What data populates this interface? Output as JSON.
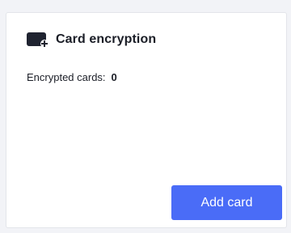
{
  "card": {
    "icon": "card-add-icon",
    "title": "Card encryption",
    "stat_label": "Encrypted cards:",
    "stat_value": "0",
    "add_button_label": "Add card"
  },
  "colors": {
    "accent": "#4a6cf7",
    "icon": "#1f2330",
    "text": "#1b1e27",
    "card_border": "#e3e5ea",
    "page_background": "#f2f3f7"
  }
}
